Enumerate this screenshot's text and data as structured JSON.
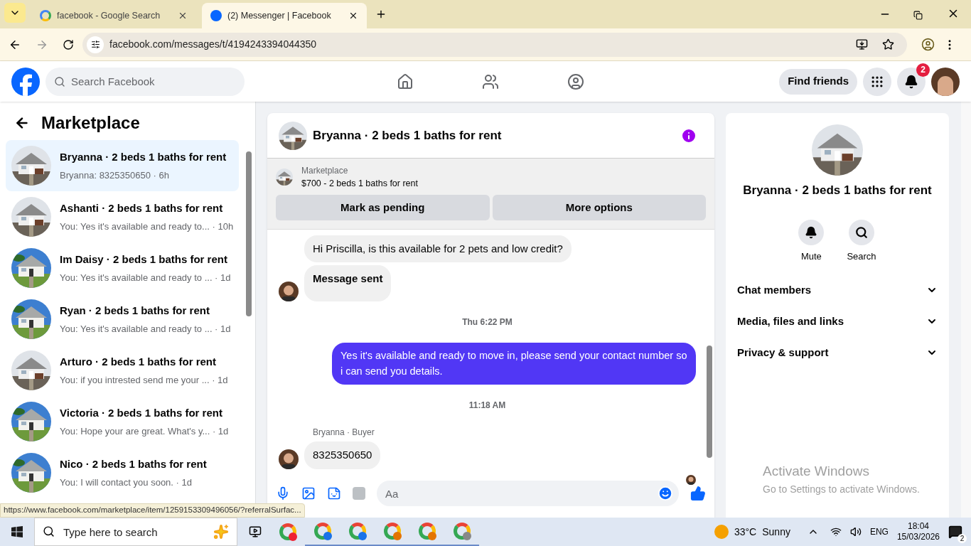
{
  "browser": {
    "tabs": [
      {
        "title": "facebook - Google Search",
        "selected": false,
        "kind": "google"
      },
      {
        "title": "(2) Messenger | Facebook",
        "selected": true,
        "kind": "facebook"
      }
    ],
    "url": "facebook.com/messages/t/4194243394044350",
    "status_url": "https://www.facebook.com/marketplace/item/1259153309496056/?referralSurfac..."
  },
  "header": {
    "search_placeholder": "Search Facebook",
    "find_friends": "Find friends",
    "notification_count": "2"
  },
  "sidebar": {
    "title": "Marketplace",
    "conversations": [
      {
        "name": "Bryanna · 2 beds 1 baths for rent",
        "preview": "Bryanna: 8325350650 · 6h",
        "selected": true
      },
      {
        "name": "Ashanti · 2 beds 1 baths for rent",
        "preview": "You: Yes it's available and ready to... · 10h",
        "selected": false
      },
      {
        "name": "Im Daisy · 2 beds 1 baths for rent",
        "preview": "You: Yes it's available and ready to ... · 1d",
        "selected": false
      },
      {
        "name": "Ryan · 2 beds 1 baths for rent",
        "preview": "You: Yes it's available and ready to ... · 1d",
        "selected": false
      },
      {
        "name": "Arturo · 2 beds 1 baths for rent",
        "preview": "You: if you intrested send me your ... · 1d",
        "selected": false
      },
      {
        "name": "Victoria · 2 beds 1 baths for rent",
        "preview": "You: Hope your are great. What's y... · 1d",
        "selected": false
      },
      {
        "name": "Nico · 2 beds 1 baths for rent",
        "preview": "You: I will contact you soon. · 1d",
        "selected": false
      }
    ]
  },
  "chat": {
    "title": "Bryanna · 2 beds 1 baths for rent",
    "listing_source": "Marketplace",
    "listing": "$700 - 2 beds 1 baths for rent",
    "actions": [
      "Mark as pending",
      "More options"
    ],
    "messages": [
      {
        "kind": "incoming",
        "text": "Hi Priscilla, is this available for 2 pets and low credit?",
        "avatar": false
      },
      {
        "kind": "notice",
        "text": "Message sent",
        "avatar": true
      },
      {
        "kind": "timestamp",
        "text": "Thu 6:22 PM"
      },
      {
        "kind": "outgoing",
        "text": "Yes it's available and ready to move in, please send your contact number so i can send you details."
      },
      {
        "kind": "timestamp",
        "text": "11:18 AM"
      },
      {
        "kind": "sender",
        "text": "Bryanna · Buyer"
      },
      {
        "kind": "incoming",
        "text": "8325350650",
        "avatar": true
      }
    ],
    "composer_placeholder": "Aa"
  },
  "details": {
    "title": "Bryanna · 2 beds 1 baths for rent",
    "actions": [
      {
        "label": "Mute",
        "kind": "bell"
      },
      {
        "label": "Search",
        "kind": "search"
      }
    ],
    "sections": [
      {
        "label": "Chat members",
        "expanded": false
      },
      {
        "label": "Media, files and links",
        "expanded": false
      },
      {
        "label": "Privacy & support",
        "expanded": false
      }
    ]
  },
  "activation": {
    "title": "Activate Windows",
    "subtitle": "Go to Settings to activate Windows."
  },
  "taskbar": {
    "search_placeholder": "Type here to search",
    "temperature": "33°C",
    "weather": "Sunny",
    "language": "ENG",
    "time": "18:04",
    "date": "15/03/2026",
    "notifications": "2"
  }
}
